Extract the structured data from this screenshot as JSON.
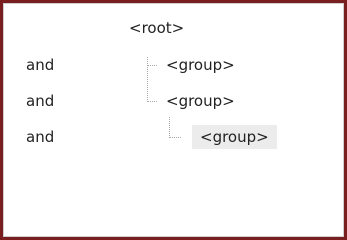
{
  "tree": {
    "root": {
      "label": "<root>"
    },
    "rows": [
      {
        "operator": "and",
        "label": "<group>",
        "selected": false
      },
      {
        "operator": "and",
        "label": "<group>",
        "selected": false
      },
      {
        "operator": "and",
        "label": "<group>",
        "selected": true
      }
    ]
  },
  "colors": {
    "frame_border": "#7a1f1f",
    "selection": "#ececec",
    "guide_lines": "#a8a8a8"
  }
}
